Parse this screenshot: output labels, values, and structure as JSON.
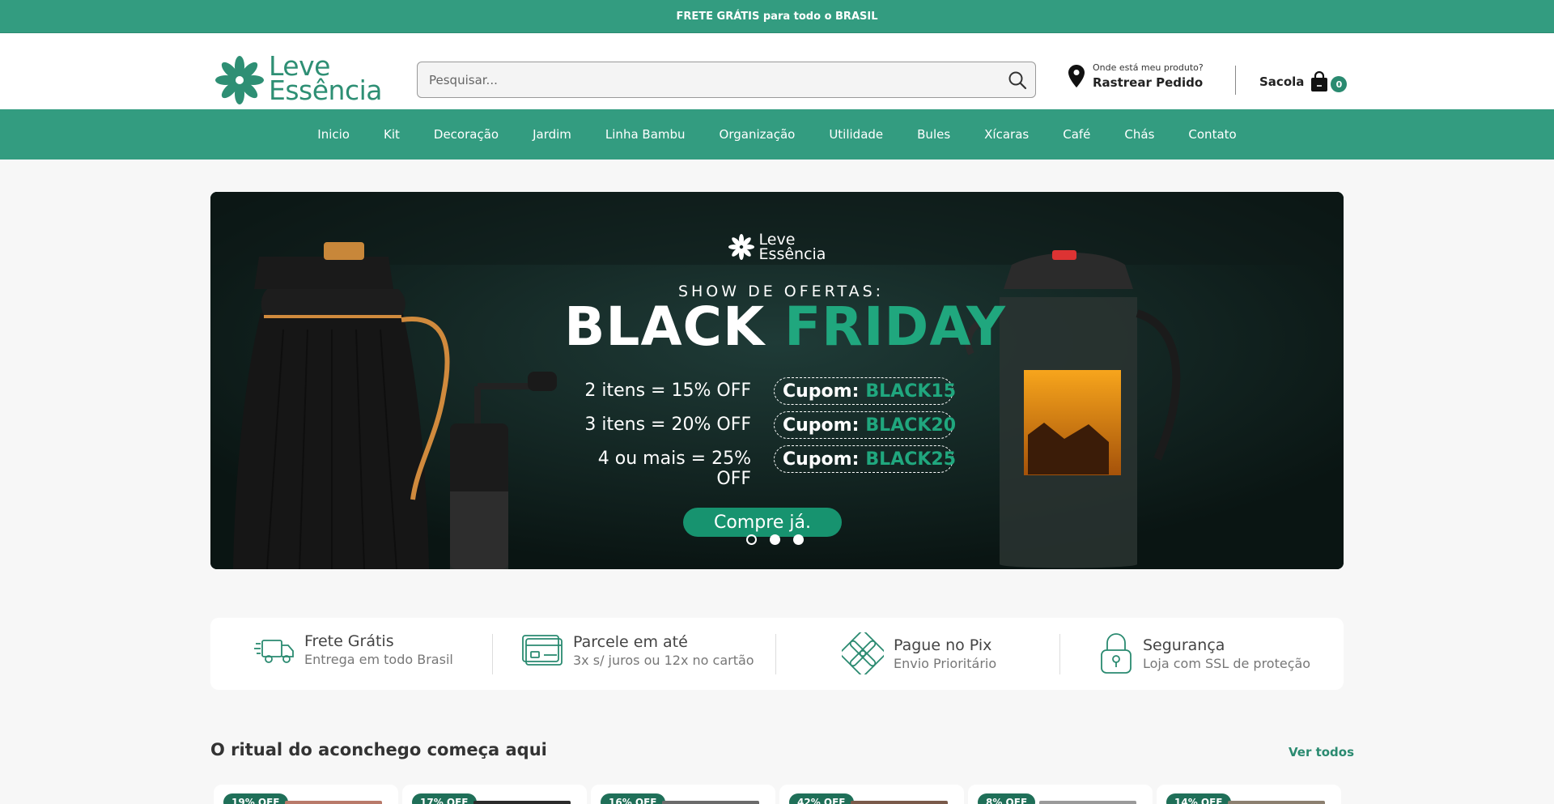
{
  "topbar": {
    "text": "FRETE GRÁTIS para todo o BRASIL"
  },
  "header": {
    "logo_line1": "Leve",
    "logo_line2": "Essência",
    "search_placeholder": "Pesquisar...",
    "track_small": "Onde está meu produto?",
    "track_big": "Rastrear Pedido",
    "cart_label": "Sacola",
    "cart_count": "0"
  },
  "nav": [
    "Inicio",
    "Kit",
    "Decoração",
    "Jardim",
    "Linha Bambu",
    "Organização",
    "Utilidade",
    "Bules",
    "Xícaras",
    "Café",
    "Chás",
    "Contato"
  ],
  "banner": {
    "logo_line1": "Leve",
    "logo_line2": "Essência",
    "show": "SHOW DE OFERTAS:",
    "title_white": "BLACK",
    "title_green": "FRIDAY",
    "offers": [
      {
        "text": "2 itens = 15% OFF",
        "coupon_label": "Cupom:",
        "coupon_code": "BLACK15"
      },
      {
        "text": "3 itens = 20% OFF",
        "coupon_label": "Cupom:",
        "coupon_code": "BLACK20"
      },
      {
        "text": "4 ou mais = 25% OFF",
        "coupon_label": "Cupom:",
        "coupon_code": "BLACK25"
      }
    ],
    "cta": "Compre já.",
    "slides": 3,
    "active_slide": 1
  },
  "features": [
    {
      "icon": "truck-icon",
      "title": "Frete Grátis",
      "sub": "Entrega em todo Brasil"
    },
    {
      "icon": "credit-card-icon",
      "title": "Parcele em até",
      "sub": "3x s/ juros ou 12x no cartão"
    },
    {
      "icon": "pix-icon",
      "title": "Pague no Pix",
      "sub": "Envio Prioritário"
    },
    {
      "icon": "padlock-icon",
      "title": "Segurança",
      "sub": "Loja com SSL de proteção"
    }
  ],
  "section": {
    "title": "O ritual do aconchego começa aqui",
    "see_all": "Ver todos"
  },
  "products": [
    {
      "badge": "19% OFF"
    },
    {
      "badge": "17% OFF"
    },
    {
      "badge": "16% OFF"
    },
    {
      "badge": "42% OFF"
    },
    {
      "badge": "8% OFF"
    },
    {
      "badge": "14% OFF"
    }
  ],
  "colors": {
    "brand": "#339c80",
    "brand_dark": "#2a8a70",
    "accent_green": "#20a77e"
  }
}
